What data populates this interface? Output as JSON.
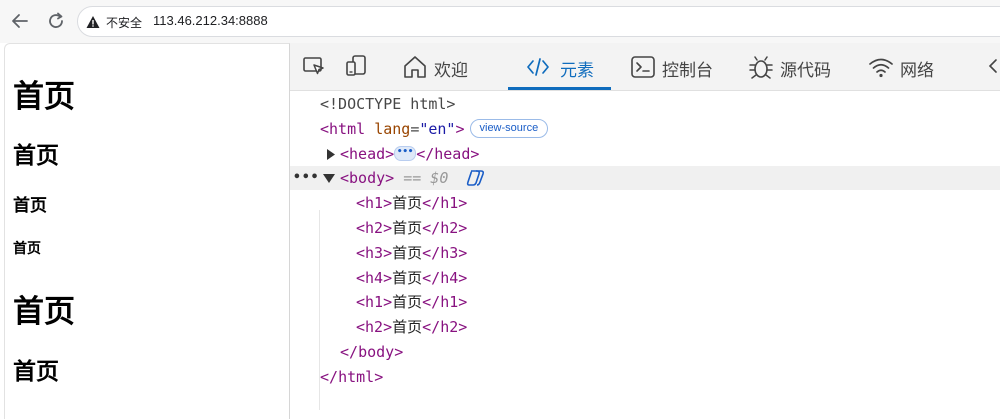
{
  "browser": {
    "security_label": "不安全",
    "url": "113.46.212.34:8888"
  },
  "page": {
    "headings": [
      {
        "level": "h1",
        "text": "首页"
      },
      {
        "level": "h2",
        "text": "首页"
      },
      {
        "level": "h3",
        "text": "首页"
      },
      {
        "level": "h4",
        "text": "首页"
      },
      {
        "level": "h1",
        "text": "首页"
      },
      {
        "level": "h2",
        "text": "首页"
      }
    ]
  },
  "devtools": {
    "tabs": [
      {
        "label": "欢迎",
        "icon": "home-icon"
      },
      {
        "label": "元素",
        "icon": "code-icon",
        "active": true
      },
      {
        "label": "控制台",
        "icon": "console-icon"
      },
      {
        "label": "源代码",
        "icon": "bug-icon"
      },
      {
        "label": "网络",
        "icon": "wifi-icon"
      }
    ],
    "tree": {
      "doctype": "<!DOCTYPE html>",
      "html_open_tag": "html",
      "html_attr_name": "lang",
      "html_attr_value": "\"en\"",
      "view_source_badge": "view-source",
      "head_tag": "head",
      "body_tag": "body",
      "selected_marker": "== $0",
      "children": [
        {
          "tag": "h1",
          "text": "首页"
        },
        {
          "tag": "h2",
          "text": "首页"
        },
        {
          "tag": "h3",
          "text": "首页"
        },
        {
          "tag": "h4",
          "text": "首页"
        },
        {
          "tag": "h1",
          "text": "首页"
        },
        {
          "tag": "h2",
          "text": "首页"
        }
      ]
    }
  },
  "colors": {
    "accent": "#0f6cbd",
    "tag": "#881280",
    "attr_name": "#994500",
    "attr_value": "#1a1aa6"
  }
}
